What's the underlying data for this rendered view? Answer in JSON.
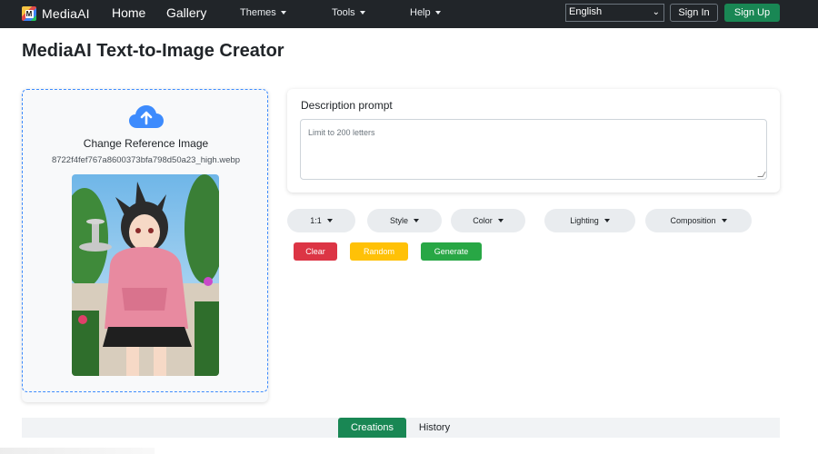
{
  "navbar": {
    "brand": "MediaAI",
    "links": [
      "Home",
      "Gallery"
    ],
    "dropdowns": [
      "Themes",
      "Tools",
      "Help"
    ],
    "language": "English",
    "signin": "Sign In",
    "signup": "Sign Up"
  },
  "page": {
    "title": "MediaAI Text-to-Image Creator"
  },
  "upload": {
    "icon": "cloud-upload-icon",
    "label": "Change Reference Image",
    "file_name": "8722f4fef767a8600373bfa798d50a23_high.webp"
  },
  "prompt": {
    "label": "Description prompt",
    "placeholder": "Limit to 200 letters"
  },
  "options": [
    "1:1",
    "Style",
    "Color",
    "Lighting",
    "Composition"
  ],
  "actions": {
    "clear": "Clear",
    "random": "Random",
    "generate": "Generate"
  },
  "tabs": [
    "Creations",
    "History"
  ],
  "colors": {
    "navbar": "#212529",
    "signup": "#198754",
    "clear": "#dc3545",
    "random": "#ffc107",
    "generate": "#28a745",
    "upload_border": "#3d8bfd"
  }
}
